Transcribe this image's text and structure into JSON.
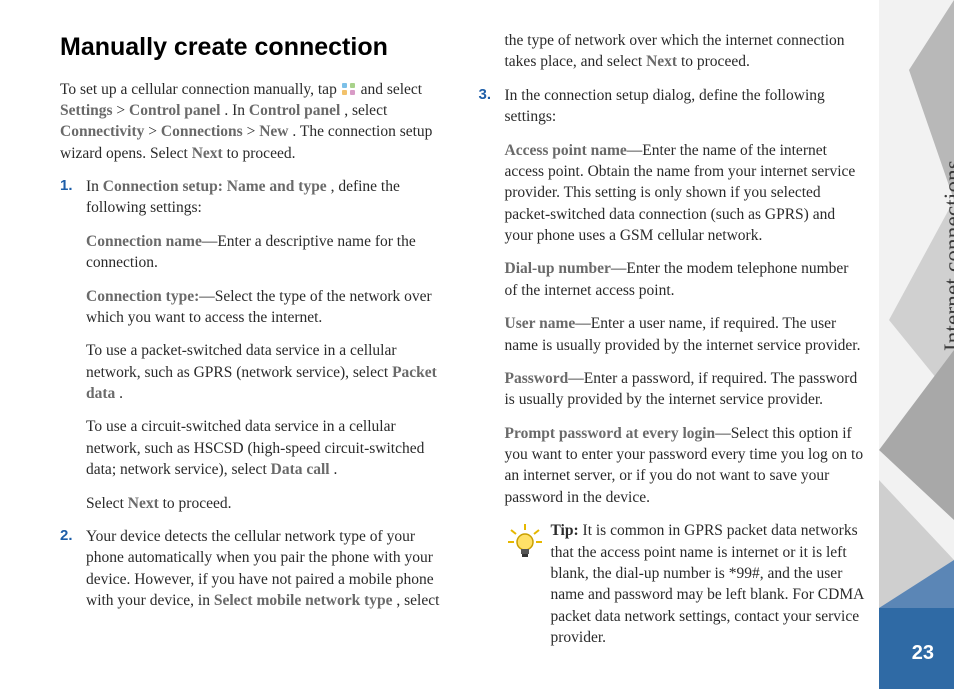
{
  "sideTab": "Internet connections",
  "pageNumber": "23",
  "heading": "Manually create connection",
  "intro": {
    "pre": "To set up a cellular connection manually, tap ",
    "post1": " and select ",
    "kw_settings": "Settings",
    "gt1": " > ",
    "kw_cp": "Control panel",
    "post2": ". In ",
    "kw_cp2": "Control panel",
    "post3": ", select ",
    "kw_conn": "Connectivity",
    "gt2": " > ",
    "kw_conns": "Connections",
    "gt3": " > ",
    "kw_new": "New",
    "post4": ". The connection setup wizard opens. Select ",
    "kw_next": "Next",
    "post5": " to proceed."
  },
  "step1": {
    "l1a": "In ",
    "l1kw": "Connection setup: Name and type",
    "l1b": ", define the following settings:",
    "c1kw": "Connection name",
    "c1t": "—Enter a descriptive name for the connection.",
    "c2kw": "Connection type:",
    "c2t": "—Select the type of the network over which you want to access the internet.",
    "p3a": "To use a packet-switched data service in a cellular network, such as GPRS (network service), select ",
    "p3kw": "Packet data",
    "p3b": ".",
    "p4a": "To use a circuit-switched data service in a cellular network, such as HSCSD (high-speed circuit-switched data; network service), select ",
    "p4kw": "Data call",
    "p4b": ".",
    "p5a": "Select ",
    "p5kw": "Next",
    "p5b": " to proceed."
  },
  "step2": {
    "a": "Your device detects the cellular network type of your phone automatically when you pair the phone with your device. However, if you have not paired a mobile phone with your device, in ",
    "kw": "Select mobile network type",
    "b": ", select the type of network over which the internet connection takes place, and select ",
    "kw2": "Next",
    "c": " to proceed."
  },
  "step3": {
    "lead": "In the connection setup dialog, define the following settings:",
    "apn_kw": "Access point name",
    "apn_t": "—Enter the name of the internet access point. Obtain the name from your internet service provider. This setting is only shown if you selected packet-switched data connection (such as GPRS) and your phone uses a GSM cellular network.",
    "dial_kw": "Dial-up number",
    "dial_t": "—Enter the modem telephone number of the internet access point.",
    "user_kw": "User name",
    "user_t": "—Enter a user name, if required. The user name is usually provided by the internet service provider.",
    "pass_kw": "Password",
    "pass_t": "—Enter a password, if required. The password is usually provided by the internet service provider.",
    "prompt_kw": "Prompt password at every login",
    "prompt_t": "—Select this option if you want to enter your password every time you log on to an internet server, or if you do not want to save your password in the device."
  },
  "tip": {
    "lead": "Tip:",
    "text": " It is common in GPRS packet data networks that the access point name is internet or it is left blank, the dial-up number is *99#, and the user name and password may be left blank. For CDMA packet data network settings, contact your service provider."
  }
}
